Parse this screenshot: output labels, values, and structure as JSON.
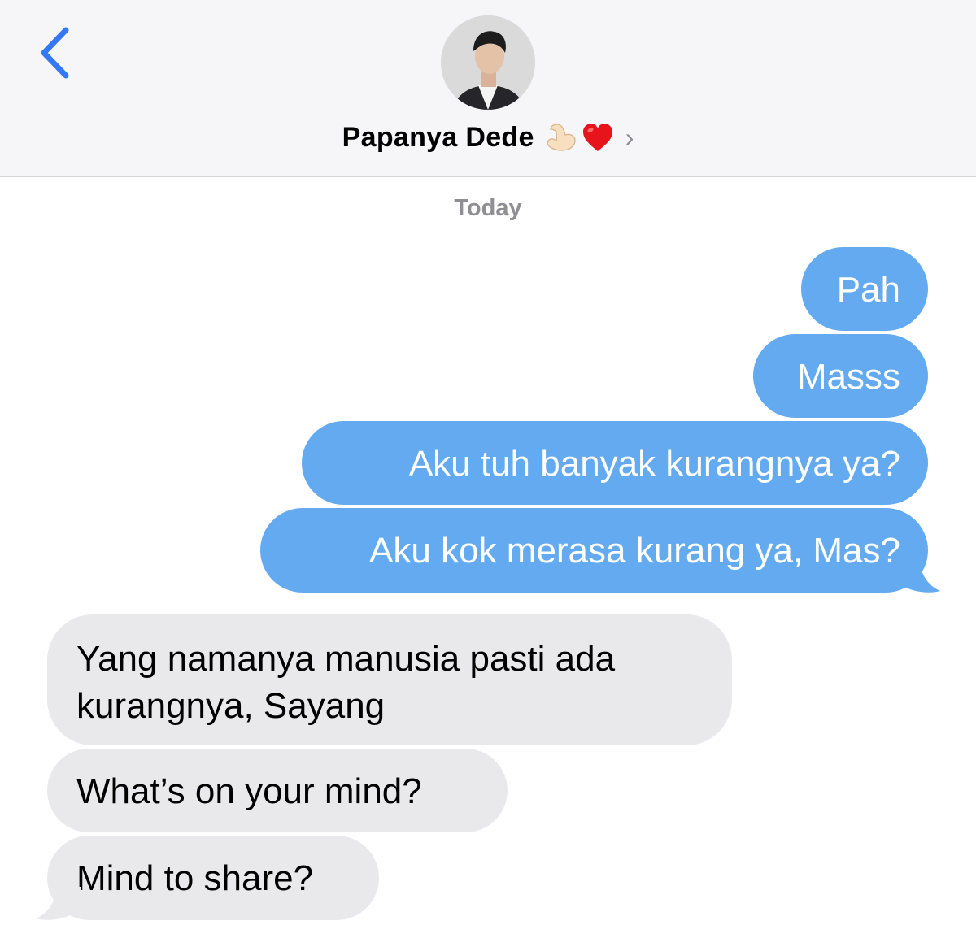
{
  "header": {
    "contact_name": "Papanya Dede",
    "emojis": [
      "flexed-biceps",
      "red-heart"
    ],
    "chevron": "›"
  },
  "colors": {
    "outgoing_bubble": "#63aaf0",
    "incoming_bubble": "#e9e9eb",
    "accent": "#3478f6"
  },
  "conversation": {
    "date_label": "Today",
    "outgoing": [
      {
        "text": "Pah"
      },
      {
        "text": "Masss"
      },
      {
        "text": "Aku tuh banyak kurangnya ya?"
      },
      {
        "text": "Aku kok merasa kurang ya, Mas?"
      }
    ],
    "incoming": [
      {
        "text": "Yang namanya manusia pasti ada kurangnya, Sayang"
      },
      {
        "text": "What’s on your mind?"
      },
      {
        "text": "Mind to share?"
      }
    ]
  }
}
